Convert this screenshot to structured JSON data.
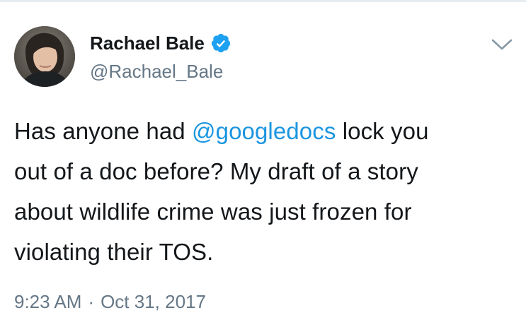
{
  "tweet": {
    "author": {
      "display_name": "Rachael Bale",
      "handle": "@Rachael_Bale",
      "verified": true,
      "avatar_icon": "profile-photo"
    },
    "text": {
      "line1_before": "Has anyone had ",
      "mention": "@googledocs",
      "line1_after": " lock you",
      "line2": "out of a doc before? My draft of a story",
      "line3": "about wildlife crime was just frozen for",
      "line4": "violating their TOS."
    },
    "time": "9:23 AM",
    "separator": "·",
    "date": "Oct 31, 2017",
    "more_icon": "chevron-down-icon"
  },
  "colors": {
    "text": "#14171a",
    "secondary": "#657786",
    "link": "#1b95e0",
    "verified_badge": "#1da1f2"
  }
}
